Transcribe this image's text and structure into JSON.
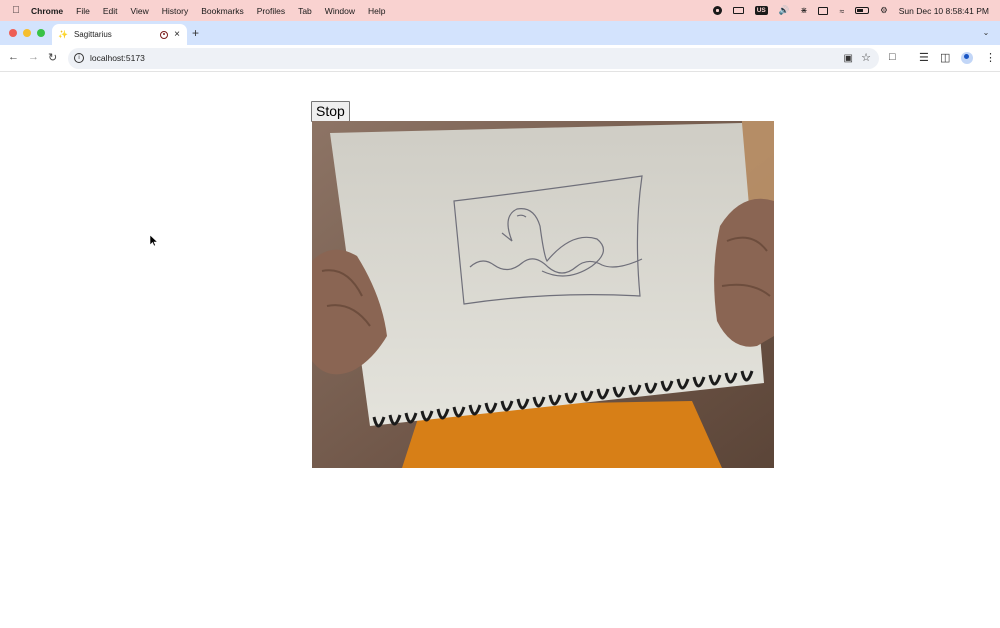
{
  "menubar": {
    "apple": "",
    "app_name": "Chrome",
    "menus": [
      "File",
      "Edit",
      "View",
      "History",
      "Bookmarks",
      "Profiles",
      "Tab",
      "Window",
      "Help"
    ],
    "keyboard_badge": "US",
    "datetime": "Sun Dec 10  8:58:41 PM"
  },
  "browser": {
    "tab_title": "Sagittarius",
    "url": "localhost:5173",
    "new_tab": "+",
    "close": "×"
  },
  "page": {
    "stop_label": "Stop"
  },
  "colors": {
    "menubar_bg": "#f9d2d0",
    "tabstrip_bg": "#d3e3fd",
    "omnibox_bg": "#eef1f6"
  }
}
